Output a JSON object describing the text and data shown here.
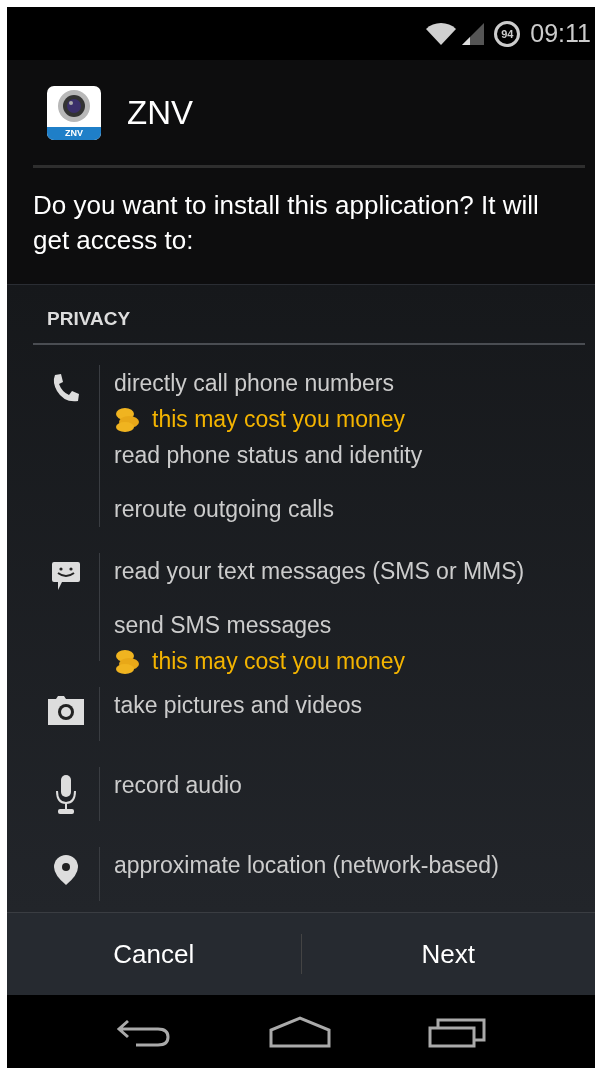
{
  "status_bar": {
    "battery": "94",
    "time": "09:11"
  },
  "app": {
    "name": "ZNV",
    "icon_label": "ZNV"
  },
  "question": "Do you want to install this application? It will get access to:",
  "section": {
    "title": "PRIVACY"
  },
  "groups": [
    {
      "kind": "phone",
      "permissions": [
        {
          "text": "directly call phone numbers",
          "warning": "this may cost you money"
        },
        {
          "text": "read phone status and identity"
        },
        {
          "text": "reroute outgoing calls"
        }
      ]
    },
    {
      "kind": "message",
      "permissions": [
        {
          "text": "read your text messages (SMS or MMS)"
        },
        {
          "text": "send SMS messages",
          "warning": "this may cost you money"
        }
      ]
    },
    {
      "kind": "camera",
      "permissions": [
        {
          "text": "take pictures and videos"
        }
      ]
    },
    {
      "kind": "microphone",
      "permissions": [
        {
          "text": "record audio"
        }
      ]
    },
    {
      "kind": "location",
      "permissions": [
        {
          "text": "approximate location (network-based)"
        }
      ]
    }
  ],
  "buttons": [
    {
      "label": "Cancel"
    },
    {
      "label": "Next"
    }
  ]
}
